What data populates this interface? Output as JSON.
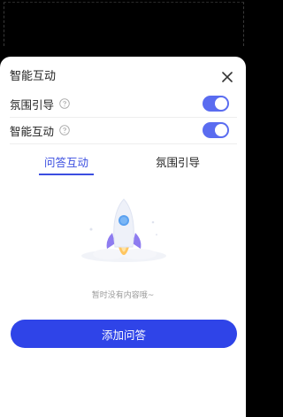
{
  "panel": {
    "title": "智能互动"
  },
  "settings": [
    {
      "label": "氛围引导",
      "enabled": true
    },
    {
      "label": "智能互动",
      "enabled": true
    }
  ],
  "tabs": [
    {
      "label": "问答互动",
      "active": true
    },
    {
      "label": "氛围引导",
      "active": false
    }
  ],
  "empty_state": {
    "message": "暂时没有内容哦~"
  },
  "add_button": {
    "label": "添加问答"
  },
  "colors": {
    "accent": "#2f44e8",
    "toggle_on": "#5a6cf0",
    "tab_active": "#3b4ee0"
  }
}
